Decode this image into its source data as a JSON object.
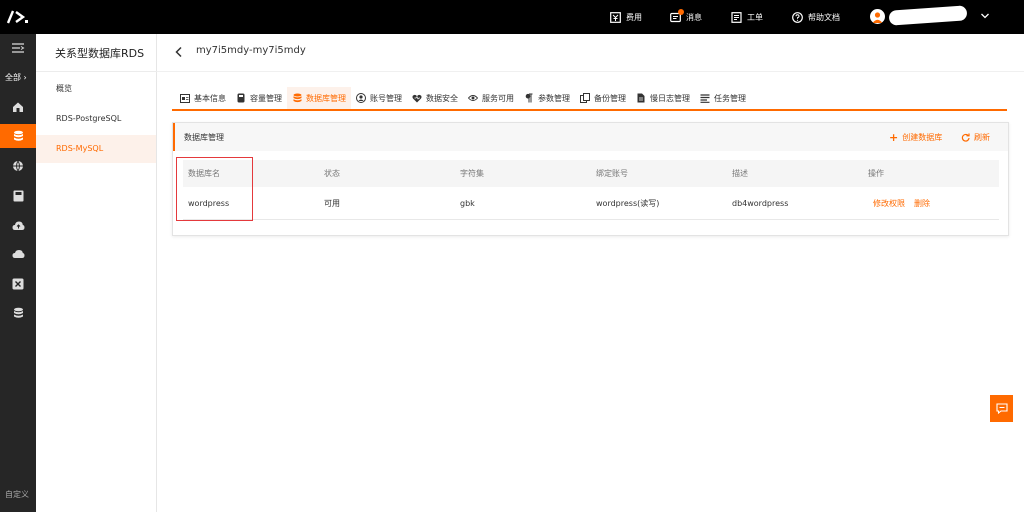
{
  "topbar": {
    "items": [
      {
        "label": "费用",
        "icon": "billing-icon"
      },
      {
        "label": "消息",
        "icon": "message-icon"
      },
      {
        "label": "工单",
        "icon": "ticket-icon"
      },
      {
        "label": "帮助文档",
        "icon": "help-icon"
      }
    ],
    "user_icon": "avatar-icon",
    "dropdown_icon": "chevron-down-icon"
  },
  "rail": {
    "all_label": "全部",
    "bottom_label": "自定义",
    "icons": [
      "home-icon",
      "database-icon",
      "globe-icon",
      "disk-icon",
      "cloud-upload-icon",
      "cloud-icon",
      "box-close-icon",
      "storage-icon"
    ]
  },
  "sidebar": {
    "title": "关系型数据库RDS",
    "items": [
      {
        "label": "概览"
      },
      {
        "label": "RDS-PostgreSQL"
      },
      {
        "label": "RDS-MySQL"
      }
    ]
  },
  "main": {
    "instance_title": "my7i5mdy-my7i5mdy",
    "tabs": [
      {
        "label": "基本信息",
        "icon": "info-card-icon"
      },
      {
        "label": "容量管理",
        "icon": "capacity-icon"
      },
      {
        "label": "数据库管理",
        "icon": "database-icon"
      },
      {
        "label": "账号管理",
        "icon": "user-icon"
      },
      {
        "label": "数据安全",
        "icon": "heart-shield-icon"
      },
      {
        "label": "服务可用",
        "icon": "eye-icon"
      },
      {
        "label": "参数管理",
        "icon": "paragraph-icon"
      },
      {
        "label": "备份管理",
        "icon": "backup-icon"
      },
      {
        "label": "慢日志管理",
        "icon": "log-file-icon"
      },
      {
        "label": "任务管理",
        "icon": "task-list-icon"
      }
    ],
    "panel": {
      "title": "数据库管理",
      "create_label": "创建数据库",
      "refresh_label": "刷新",
      "columns": [
        "数据库名",
        "状态",
        "字符集",
        "绑定账号",
        "描述",
        "操作"
      ],
      "rows": [
        {
          "name": "wordpress",
          "status": "可用",
          "charset": "gbk",
          "account": "wordpress(读写)",
          "description": "db4wordpress",
          "actions": [
            "修改权限",
            "删除"
          ]
        }
      ]
    }
  },
  "colors": {
    "accent": "#ff6a00",
    "topbar": "#000000",
    "rail": "#262626",
    "highlight": "#e4393c"
  }
}
